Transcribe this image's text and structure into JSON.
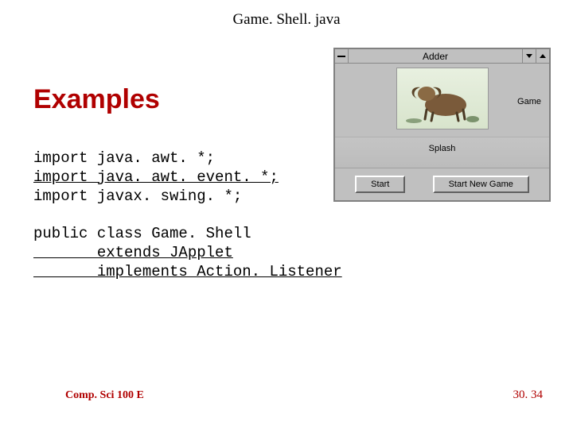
{
  "filename": "Game. Shell. java",
  "heading": "Examples",
  "code": {
    "line1": "import java. awt. *;",
    "line2": "import java. awt. event. *;",
    "line3": "import javax. swing. *;",
    "line5": "public class Game. Shell",
    "line6": "       extends JApplet",
    "line7": "       implements Action. Listener"
  },
  "applet": {
    "title": "Adder",
    "game_label": "Game",
    "splash_label": "Splash",
    "buttons": {
      "start": "Start",
      "start_new_game": "Start New Game"
    }
  },
  "footer": {
    "left": "Comp. Sci 100 E",
    "right": "30. 34"
  }
}
